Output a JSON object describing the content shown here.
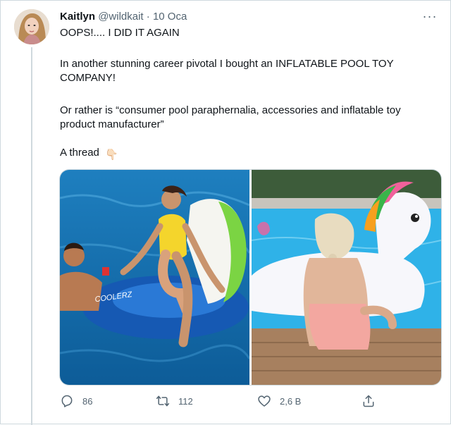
{
  "tweet": {
    "author_name": "Kaitlyn",
    "handle": "@wildkait",
    "separator": "·",
    "date": "10 Oca",
    "more_label": "···",
    "paragraphs": [
      "OOPS!.... I DID IT AGAIN",
      "In another stunning career pivotal I bought an INFLATABLE POOL TOY COMPANY!",
      "Or rather is “consumer pool paraphernalia, accessories and inflatable toy product manufacturer”",
      "A thread"
    ],
    "thread_emoji": "👇🏻"
  },
  "actions": {
    "reply_count": "86",
    "retweet_count": "112",
    "like_count": "2,6 B"
  },
  "icons": {
    "reply": "reply-icon",
    "retweet": "retweet-icon",
    "like": "heart-icon",
    "share": "share-icon",
    "more": "more-options-icon"
  },
  "colors": {
    "text": "#0f1419",
    "muted": "#536471",
    "border": "#cfd9de"
  }
}
